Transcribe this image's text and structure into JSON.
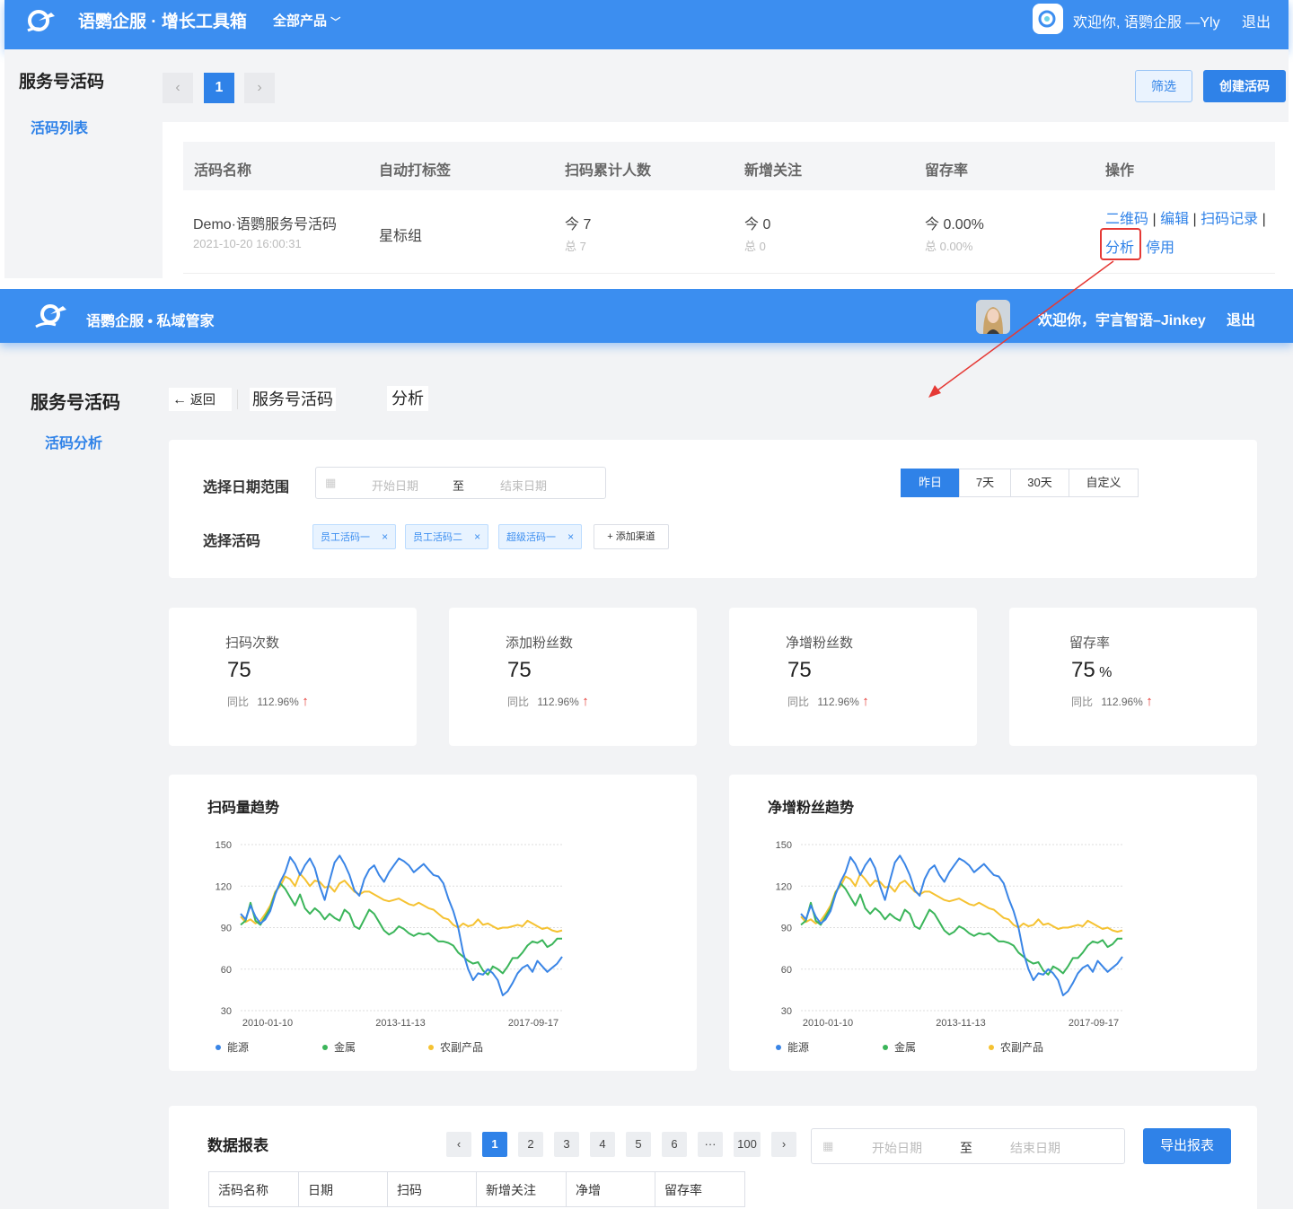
{
  "shot_a": {
    "header": {
      "brand": "语鹦企服 · 增长工具箱",
      "product_menu": "全部产品",
      "welcome": "欢迎你, 语鹦企服 —Yly",
      "logout": "退出"
    },
    "sidebar": {
      "title": "服务号活码",
      "item": "活码列表"
    },
    "pagination": {
      "prev": "‹",
      "current": "1",
      "next": "›"
    },
    "buttons": {
      "filter": "筛选",
      "create": "创建活码"
    },
    "table": {
      "headers": [
        "活码名称",
        "自动打标签",
        "扫码累计人数",
        "新增关注",
        "留存率",
        "操作"
      ],
      "row": {
        "name": "Demo·语鹦服务号活码",
        "created": "2021-10-20 16:00:31",
        "tag": "星标组",
        "scan_today": "今 7",
        "scan_total": "总 7",
        "follow_today": "今 0",
        "follow_total": "总 0",
        "retention_today": "今 0.00%",
        "retention_total": "总 0.00%",
        "actions": [
          "二维码",
          "编辑",
          "扫码记录",
          "分析",
          "停用"
        ],
        "sep": "|"
      }
    },
    "highlight_color": "#e53935"
  },
  "shot_b": {
    "header": {
      "brand": "语鹦企服 • 私域管家",
      "welcome": "欢迎你，宇言智语–Jinkey",
      "logout": "退出"
    },
    "sidebar": {
      "title": "服务号活码",
      "item": "活码分析"
    },
    "breadcrumb": {
      "back": "返回",
      "parent": "服务号活码",
      "current": "分析"
    },
    "filters": {
      "date_label": "选择日期范围",
      "start_placeholder": "开始日期",
      "to": "至",
      "end_placeholder": "结束日期",
      "ranges": [
        "昨日",
        "7天",
        "30天",
        "自定义"
      ],
      "code_label": "选择活码",
      "tags": [
        "员工活码一",
        "员工活码二",
        "超级活码一"
      ],
      "tag_close": "×",
      "add_channel": "+ 添加渠道"
    },
    "stats": [
      {
        "title": "扫码次数",
        "value": "75",
        "unit": "",
        "compare_label": "同比",
        "compare_value": "112.96%"
      },
      {
        "title": "添加粉丝数",
        "value": "75",
        "unit": "",
        "compare_label": "同比",
        "compare_value": "112.96%"
      },
      {
        "title": "净增粉丝数",
        "value": "75",
        "unit": "",
        "compare_label": "同比",
        "compare_value": "112.96%"
      },
      {
        "title": "留存率",
        "value": "75",
        "unit": "%",
        "compare_label": "同比",
        "compare_value": "112.96%"
      }
    ],
    "report": {
      "title": "数据报表",
      "pages": [
        "‹",
        "1",
        "2",
        "3",
        "4",
        "5",
        "6",
        "···",
        "100",
        "›"
      ],
      "start_placeholder": "开始日期",
      "to": "至",
      "end_placeholder": "结束日期",
      "export": "导出报表",
      "columns": [
        "活码名称",
        "日期",
        "扫码",
        "新增关注",
        "净增",
        "留存率"
      ]
    },
    "colors": {
      "energy": "#3a85e6",
      "metal": "#3bb55a",
      "agri": "#f5c232",
      "accent": "#2f82e8"
    }
  },
  "chart_data": [
    {
      "type": "line",
      "title": "扫码量趋势",
      "x_ticks": [
        "2010-01-10",
        "2013-11-13",
        "2017-09-17"
      ],
      "y_ticks": [
        30,
        60,
        90,
        120,
        150
      ],
      "ylim": [
        30,
        150
      ],
      "grid": true,
      "legend": "bottom-left",
      "series": [
        {
          "name": "能源",
          "values": [
            100,
            96,
            106,
            98,
            93,
            96,
            102,
            114,
            123,
            130,
            141,
            136,
            128,
            135,
            140,
            133,
            120,
            110,
            124,
            137,
            142,
            136,
            128,
            117,
            113,
            125,
            132,
            135,
            128,
            123,
            130,
            135,
            140,
            138,
            135,
            130,
            133,
            136,
            132,
            128,
            127,
            122,
            111,
            102,
            90,
            72,
            60,
            52,
            57,
            56,
            60,
            57,
            52,
            41,
            44,
            50,
            57,
            61,
            63,
            58,
            66,
            62,
            58,
            61,
            64,
            69
          ]
        },
        {
          "name": "金属",
          "values": [
            92,
            95,
            108,
            95,
            92,
            98,
            104,
            115,
            122,
            118,
            112,
            106,
            114,
            104,
            100,
            104,
            101,
            96,
            100,
            97,
            95,
            103,
            100,
            91,
            89,
            96,
            103,
            100,
            94,
            88,
            85,
            87,
            91,
            89,
            86,
            84,
            86,
            85,
            86,
            83,
            80,
            80,
            79,
            77,
            72,
            69,
            66,
            64,
            65,
            59,
            56,
            62,
            60,
            57,
            62,
            68,
            68,
            72,
            77,
            80,
            79,
            81,
            76,
            78,
            82,
            82
          ]
        },
        {
          "name": "农副产品",
          "values": [
            98,
            94,
            96,
            93,
            95,
            100,
            106,
            116,
            120,
            127,
            125,
            120,
            129,
            125,
            120,
            124,
            123,
            119,
            120,
            116,
            122,
            124,
            120,
            116,
            114,
            116,
            116,
            114,
            112,
            110,
            109,
            110,
            111,
            109,
            107,
            106,
            108,
            106,
            104,
            103,
            100,
            97,
            96,
            92,
            90,
            93,
            91,
            92,
            96,
            92,
            93,
            91,
            89,
            90,
            90,
            91,
            92,
            91,
            95,
            93,
            91,
            89,
            90,
            88,
            87,
            88
          ]
        }
      ]
    },
    {
      "type": "line",
      "title": "净增粉丝趋势",
      "x_ticks": [
        "2010-01-10",
        "2013-11-13",
        "2017-09-17"
      ],
      "y_ticks": [
        30,
        60,
        90,
        120,
        150
      ],
      "ylim": [
        30,
        150
      ],
      "grid": true,
      "legend": "bottom-left",
      "series": [
        {
          "name": "能源",
          "values": [
            100,
            96,
            106,
            98,
            93,
            96,
            102,
            114,
            123,
            130,
            141,
            136,
            128,
            135,
            140,
            133,
            120,
            110,
            124,
            137,
            142,
            136,
            128,
            117,
            113,
            125,
            132,
            135,
            128,
            123,
            130,
            135,
            140,
            138,
            135,
            130,
            133,
            136,
            132,
            128,
            127,
            122,
            111,
            102,
            90,
            72,
            60,
            52,
            57,
            56,
            60,
            57,
            52,
            41,
            44,
            50,
            57,
            61,
            63,
            58,
            66,
            62,
            58,
            61,
            64,
            69
          ]
        },
        {
          "name": "金属",
          "values": [
            92,
            95,
            108,
            95,
            92,
            98,
            104,
            115,
            122,
            118,
            112,
            106,
            114,
            104,
            100,
            104,
            101,
            96,
            100,
            97,
            95,
            103,
            100,
            91,
            89,
            96,
            103,
            100,
            94,
            88,
            85,
            87,
            91,
            89,
            86,
            84,
            86,
            85,
            86,
            83,
            80,
            80,
            79,
            77,
            72,
            69,
            66,
            64,
            65,
            59,
            56,
            62,
            60,
            57,
            62,
            68,
            68,
            72,
            77,
            80,
            79,
            81,
            76,
            78,
            82,
            82
          ]
        },
        {
          "name": "农副产品",
          "values": [
            98,
            94,
            96,
            93,
            95,
            100,
            106,
            116,
            120,
            127,
            125,
            120,
            129,
            125,
            120,
            124,
            123,
            119,
            120,
            116,
            122,
            124,
            120,
            116,
            114,
            116,
            116,
            114,
            112,
            110,
            109,
            110,
            111,
            109,
            107,
            106,
            108,
            106,
            104,
            103,
            100,
            97,
            96,
            92,
            90,
            93,
            91,
            92,
            96,
            92,
            93,
            91,
            89,
            90,
            90,
            91,
            92,
            91,
            95,
            93,
            91,
            89,
            90,
            88,
            87,
            88
          ]
        }
      ]
    }
  ]
}
